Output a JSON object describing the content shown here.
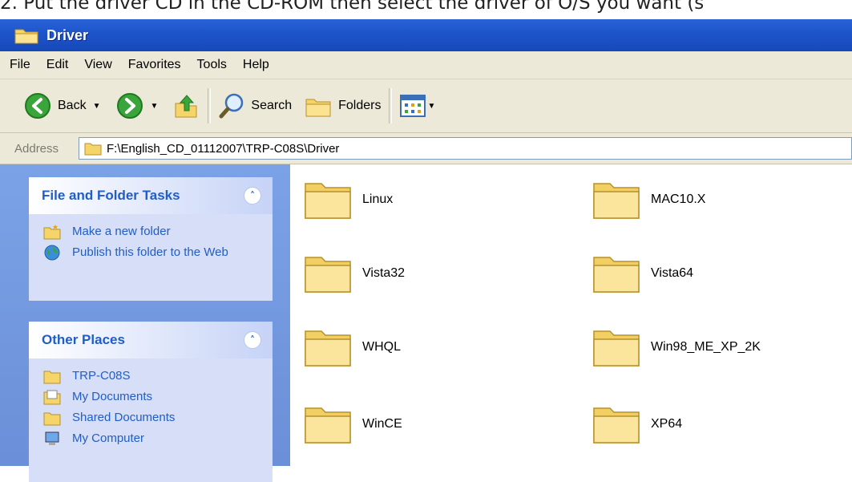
{
  "caption": "2. Put the driver CD in the CD-ROM then select the driver of O/S you want (s",
  "window": {
    "title": "Driver"
  },
  "menu": [
    "File",
    "Edit",
    "View",
    "Favorites",
    "Tools",
    "Help"
  ],
  "toolbar": {
    "back": "Back",
    "search": "Search",
    "folders": "Folders"
  },
  "address": {
    "label": "Address",
    "path": "F:\\English_CD_01112007\\TRP-C08S\\Driver"
  },
  "panels": {
    "tasks": {
      "title": "File and Folder Tasks",
      "items": [
        "Make a new folder",
        "Publish this folder to the Web"
      ]
    },
    "places": {
      "title": "Other Places",
      "items": [
        "TRP-C08S",
        "My Documents",
        "Shared Documents",
        "My Computer"
      ]
    }
  },
  "folders": [
    "Linux",
    "MAC10.X",
    "Vista32",
    "Vista64",
    "WHQL",
    "Win98_ME_XP_2K",
    "WinCE",
    "XP64"
  ],
  "colors": {
    "titlebar": "#1e55cc",
    "sidebar": "#6b8fd8",
    "link": "#215dc6",
    "chrome": "#ece9d8"
  }
}
